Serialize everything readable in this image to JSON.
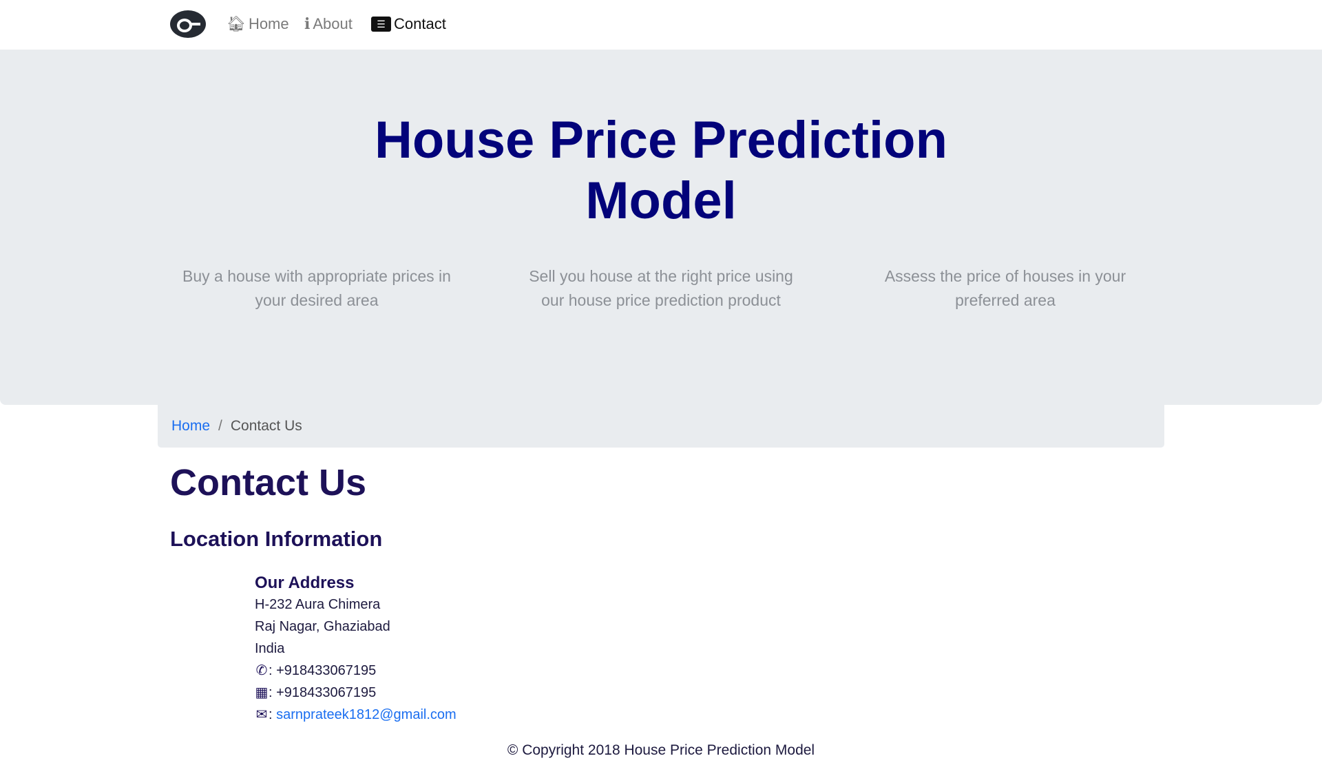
{
  "nav": {
    "home": "Home",
    "about": "About",
    "contact": "Contact"
  },
  "hero": {
    "title_line1": "House Price Prediction",
    "title_line2": "Model",
    "features": [
      "Buy a house with appropriate prices in your desired area",
      "Sell you house at the right price using our house price prediction product",
      "Assess the price of houses in your preferred area"
    ]
  },
  "breadcrumb": {
    "home": "Home",
    "separator": "/",
    "current": "Contact Us"
  },
  "page_title": "Contact Us",
  "section_title": "Location Information",
  "address": {
    "heading": "Our Address",
    "line1": "H-232 Aura Chimera",
    "line2": "Raj Nagar, Ghaziabad",
    "line3": "India",
    "phone": ": +918433067195",
    "fax": ": +918433067195",
    "email_prefix": ": ",
    "email": "sarnprateek1812@gmail.com"
  },
  "footer": "© Copyright 2018 House Price Prediction Model",
  "colors": {
    "title": "#03037a",
    "heading": "#1d1158",
    "link": "#1a6ef0",
    "jumbotron": "#e9ecef"
  }
}
